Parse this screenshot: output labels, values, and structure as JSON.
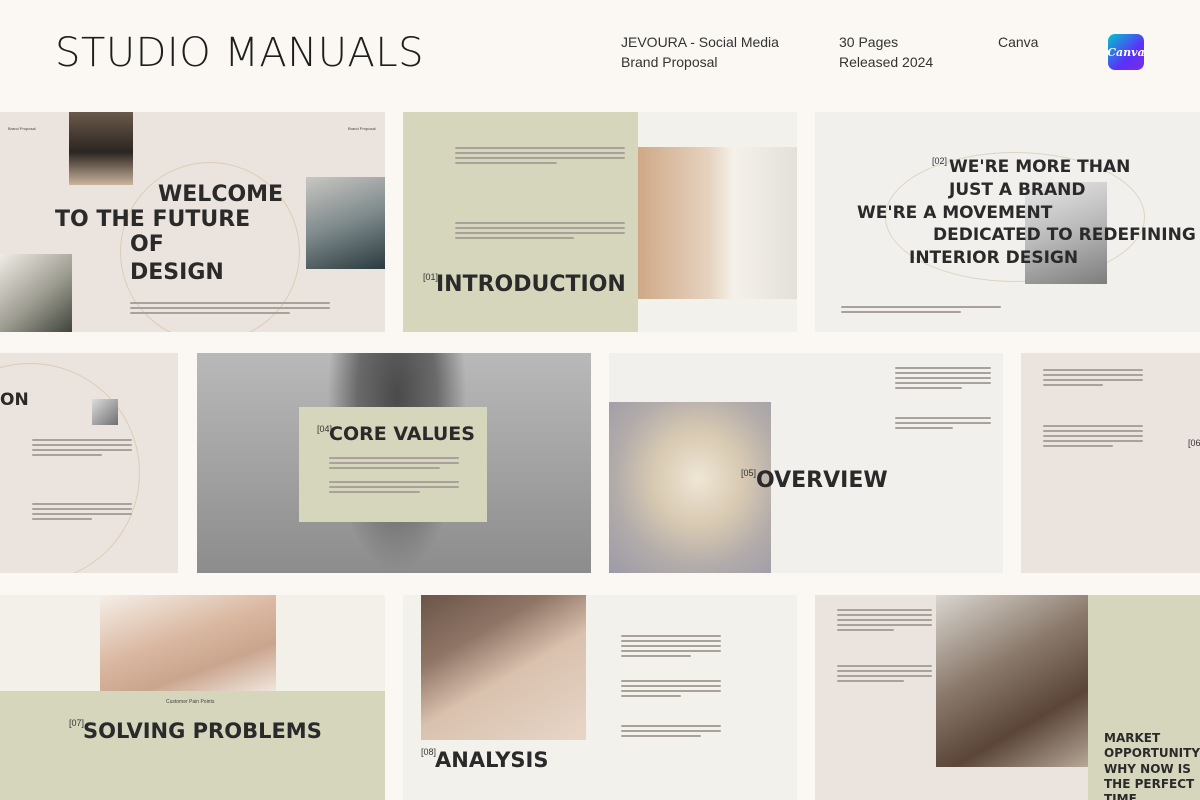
{
  "header": {
    "title": "STUDIO MANUALS",
    "product_line1": "JEVOURA - Social Media",
    "product_line2": "Brand Proposal",
    "pages": "30 Pages",
    "released": "Released 2024",
    "platform": "Canva",
    "badge_text": "Canva"
  },
  "slides": {
    "welcome": {
      "l1": "WELCOME",
      "l2": "TO THE FUTURE",
      "l3": "OF",
      "l4": "DESIGN"
    },
    "intro": {
      "num": "[01]",
      "title": "INTRODUCTION"
    },
    "more": {
      "num": "[02]",
      "l1": "WE'RE MORE THAN",
      "l2": "JUST A BRAND",
      "l3": "WE'RE A MOVEMENT",
      "l4": "DEDICATED TO REDEFINING",
      "l5": "INTERIOR DESIGN"
    },
    "partial_left": {
      "title": "ON"
    },
    "core": {
      "num": "[04]",
      "title": "CORE VALUES"
    },
    "overview": {
      "num": "[05]",
      "title": "OVERVIEW"
    },
    "partial_right": {
      "num": "[06"
    },
    "solving": {
      "caption": "Customer Pain Points",
      "num": "[07]",
      "title": "SOLVING PROBLEMS"
    },
    "analysis": {
      "num": "[08]",
      "title": "ANALYSIS"
    },
    "market": {
      "l1": "MARKET",
      "l2": "OPPORTUNITY",
      "l3": "WHY NOW IS",
      "l4": "THE PERFECT",
      "l5": "TIME"
    }
  },
  "colors": {
    "background": "#fbf8f3",
    "sage": "#d6d6bd",
    "blush": "#ebe3dd",
    "badge_start": "#00c4cc",
    "badge_end": "#7d2ae8"
  }
}
